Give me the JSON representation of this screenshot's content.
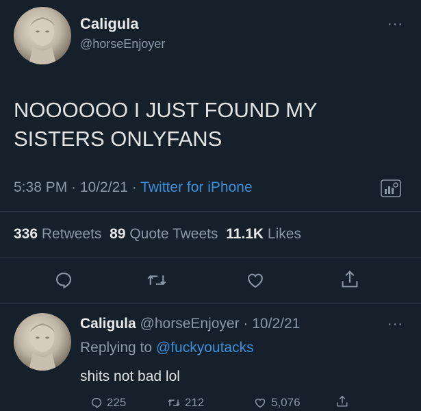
{
  "main_tweet": {
    "author_name": "Caligula",
    "author_handle": "@horseEnjoyer",
    "more_label": "···",
    "text_line1": "NOOOOOO I JUST FOUND MY",
    "text_line2": "SISTERS ONLYFANS",
    "time": "5:38 PM · 10/2/21 · ",
    "source": "Twitter for iPhone",
    "stats": {
      "retweets_count": "336",
      "retweets_label": "Retweets",
      "quotes_count": "89",
      "quotes_label": "Quote Tweets",
      "likes_count": "11.1K",
      "likes_label": "Likes"
    },
    "actions": [
      "reply-icon",
      "retweet-icon",
      "like-icon",
      "share-icon"
    ]
  },
  "reply_tweet": {
    "author_name": "Caligula",
    "meta": "@horseEnjoyer · 10/2/21",
    "more_label": "···",
    "replying_prefix": "Replying to ",
    "replying_to": "@fuckyoutacks",
    "text": "shits not bad lol",
    "reply_count": "225",
    "retweet_count": "212",
    "like_count": "5,076"
  },
  "colors": {
    "background": "#15202b",
    "text": "#d9d9d9",
    "muted": "#8b98a5",
    "link": "#3d8fd9",
    "divider": "#2f3b47"
  }
}
